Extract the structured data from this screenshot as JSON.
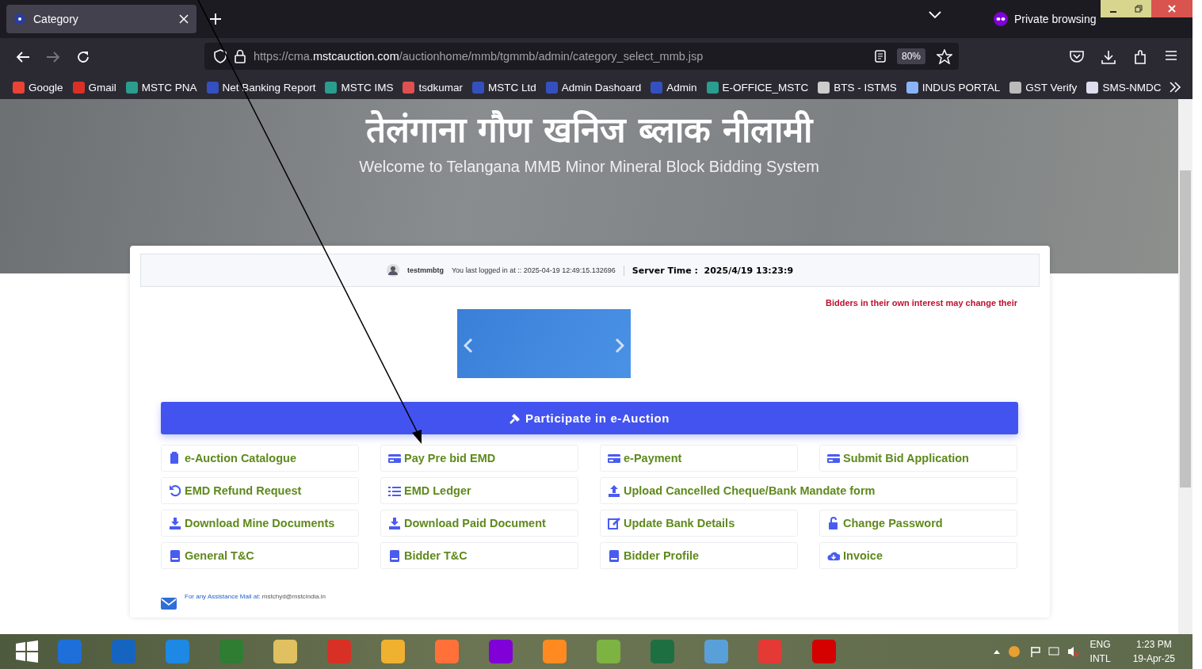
{
  "browser": {
    "tab_title": "Category",
    "private_label": "Private browsing",
    "url_prefix": "https://cma.",
    "url_domain": "mstcauction.com",
    "url_path": "/auctionhome/mmb/tgmmb/admin/category_select_mmb.jsp",
    "zoom": "80%"
  },
  "bookmarks": [
    "Google",
    "Gmail",
    "MSTC PNA",
    "Net Banking Report",
    "MSTC IMS",
    "tsdkumar",
    "MSTC Ltd",
    "Admin Dashoard",
    "Admin",
    "E-OFFICE_MSTC",
    "BTS - ISTMS",
    "INDUS PORTAL",
    "GST Verify",
    "SMS-NMDC"
  ],
  "page": {
    "title": "तेलंगाना गौण खनिज ब्लाक नीलामी",
    "subtitle": "Welcome to Telangana MMB Minor Mineral Block Bidding System",
    "user": "testmmbtg",
    "last_login": "You last logged in at :: 2025-04-19 12:49:15.132696",
    "server_time_label": "Server Time :",
    "server_time": "2025/4/19 13:23:9",
    "notice": "Bidders in their own interest may change their",
    "main_action": "Participate in e-Auction",
    "menu": [
      {
        "label": "e-Auction Catalogue",
        "wide": false
      },
      {
        "label": "Pay Pre bid EMD",
        "wide": false
      },
      {
        "label": "e-Payment",
        "wide": false
      },
      {
        "label": "Submit Bid Application",
        "wide": false
      },
      {
        "label": "EMD Refund Request",
        "wide": false
      },
      {
        "label": "EMD Ledger",
        "wide": false
      },
      {
        "label": "Upload Cancelled Cheque/Bank Mandate form",
        "wide": true
      },
      {
        "label": "Download Mine Documents",
        "wide": false
      },
      {
        "label": "Download Paid Document",
        "wide": false
      },
      {
        "label": "Update Bank Details",
        "wide": false
      },
      {
        "label": "Change Password",
        "wide": false
      },
      {
        "label": "General T&C",
        "wide": false
      },
      {
        "label": "Bidder T&C",
        "wide": false
      },
      {
        "label": "Bidder Profile",
        "wide": false
      },
      {
        "label": "Invoice",
        "wide": false
      }
    ],
    "assistance_label": "For any Assistance Mail at:",
    "assistance_email": "mstchyd@mstcindia.in"
  },
  "taskbar": {
    "language": "ENG",
    "layout": "INTL",
    "time": "1:23 PM",
    "date": "19-Apr-25"
  }
}
